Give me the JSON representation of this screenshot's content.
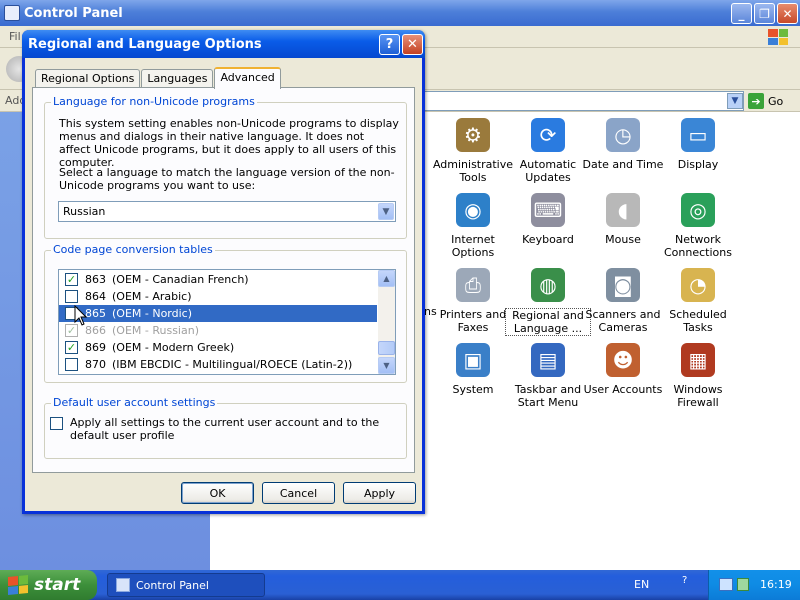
{
  "control_panel": {
    "title": "Control Panel",
    "menu_first": "Fil",
    "address_label": "Add",
    "go_label": "Go",
    "cut_off_label": "ns",
    "icons": [
      {
        "label": "Administrative Tools",
        "icon": "administrative-tools-icon",
        "color": "#9a7a3c",
        "glyph": "⚙"
      },
      {
        "label": "Automatic Updates",
        "icon": "automatic-updates-icon",
        "color": "#2a7be0",
        "glyph": "⟳"
      },
      {
        "label": "Date and Time",
        "icon": "date-and-time-icon",
        "color": "#8aa4c8",
        "glyph": "◷"
      },
      {
        "label": "Display",
        "icon": "display-icon",
        "color": "#3a86d6",
        "glyph": "▭"
      },
      {
        "label": "Internet Options",
        "icon": "internet-options-icon",
        "color": "#2d80c9",
        "glyph": "◉"
      },
      {
        "label": "Keyboard",
        "icon": "keyboard-icon",
        "color": "#8e8e9e",
        "glyph": "⌨"
      },
      {
        "label": "Mouse",
        "icon": "mouse-icon",
        "color": "#b8b8b8",
        "glyph": "◖"
      },
      {
        "label": "Network Connections",
        "icon": "network-connections-icon",
        "color": "#2aa05a",
        "glyph": "◎"
      },
      {
        "label": "Printers and Faxes",
        "icon": "printers-and-faxes-icon",
        "color": "#9ca8b8",
        "glyph": "⎙"
      },
      {
        "label": "Regional and Language ...",
        "icon": "regional-and-language-icon",
        "color": "#3a8f4a",
        "glyph": "◍"
      },
      {
        "label": "Scanners and Cameras",
        "icon": "scanners-and-cameras-icon",
        "color": "#7f8fa0",
        "glyph": "◙"
      },
      {
        "label": "Scheduled Tasks",
        "icon": "scheduled-tasks-icon",
        "color": "#d8b450",
        "glyph": "◔"
      },
      {
        "label": "System",
        "icon": "system-icon",
        "color": "#3a7fc8",
        "glyph": "▣"
      },
      {
        "label": "Taskbar and Start Menu",
        "icon": "taskbar-and-start-menu-icon",
        "color": "#3468c0",
        "glyph": "▤"
      },
      {
        "label": "User Accounts",
        "icon": "user-accounts-icon",
        "color": "#c06030",
        "glyph": "☻"
      },
      {
        "label": "Windows Firewall",
        "icon": "windows-firewall-icon",
        "color": "#b03a20",
        "glyph": "▦"
      }
    ]
  },
  "dialog": {
    "title": "Regional and Language Options",
    "help_label": "?",
    "close_label": "✕",
    "tabs": [
      {
        "label": "Regional Options"
      },
      {
        "label": "Languages"
      },
      {
        "label": "Advanced"
      }
    ],
    "non_unicode": {
      "legend": "Language for non-Unicode programs",
      "description": "This system setting enables non-Unicode programs to display menus and dialogs in their native language. It does not affect Unicode programs, but it does apply to all users of this computer.",
      "prompt": "Select a language to match the language version of the non-Unicode programs you want to use:",
      "selected_language": "Russian"
    },
    "code_page": {
      "legend": "Code page conversion tables",
      "rows": [
        {
          "code": "863",
          "name": "(OEM - Canadian French)",
          "checked": true,
          "disabled": false,
          "selected": false
        },
        {
          "code": "864",
          "name": "(OEM - Arabic)",
          "checked": false,
          "disabled": false,
          "selected": false
        },
        {
          "code": "865",
          "name": "(OEM - Nordic)",
          "checked": false,
          "disabled": false,
          "selected": true
        },
        {
          "code": "866",
          "name": "(OEM - Russian)",
          "checked": true,
          "disabled": true,
          "selected": false
        },
        {
          "code": "869",
          "name": "(OEM - Modern Greek)",
          "checked": true,
          "disabled": false,
          "selected": false
        },
        {
          "code": "870",
          "name": "(IBM EBCDIC - Multilingual/ROECE (Latin-2))",
          "checked": false,
          "disabled": false,
          "selected": false
        }
      ]
    },
    "default_user": {
      "legend": "Default user account settings",
      "checkbox_label": "Apply all settings to the current user account and to the default user profile",
      "checked": false
    },
    "buttons": {
      "ok": "OK",
      "cancel": "Cancel",
      "apply": "Apply"
    }
  },
  "taskbar": {
    "start_label": "start",
    "task_label": "Control Panel",
    "language": "EN",
    "help": "?",
    "clock": "16:19"
  }
}
